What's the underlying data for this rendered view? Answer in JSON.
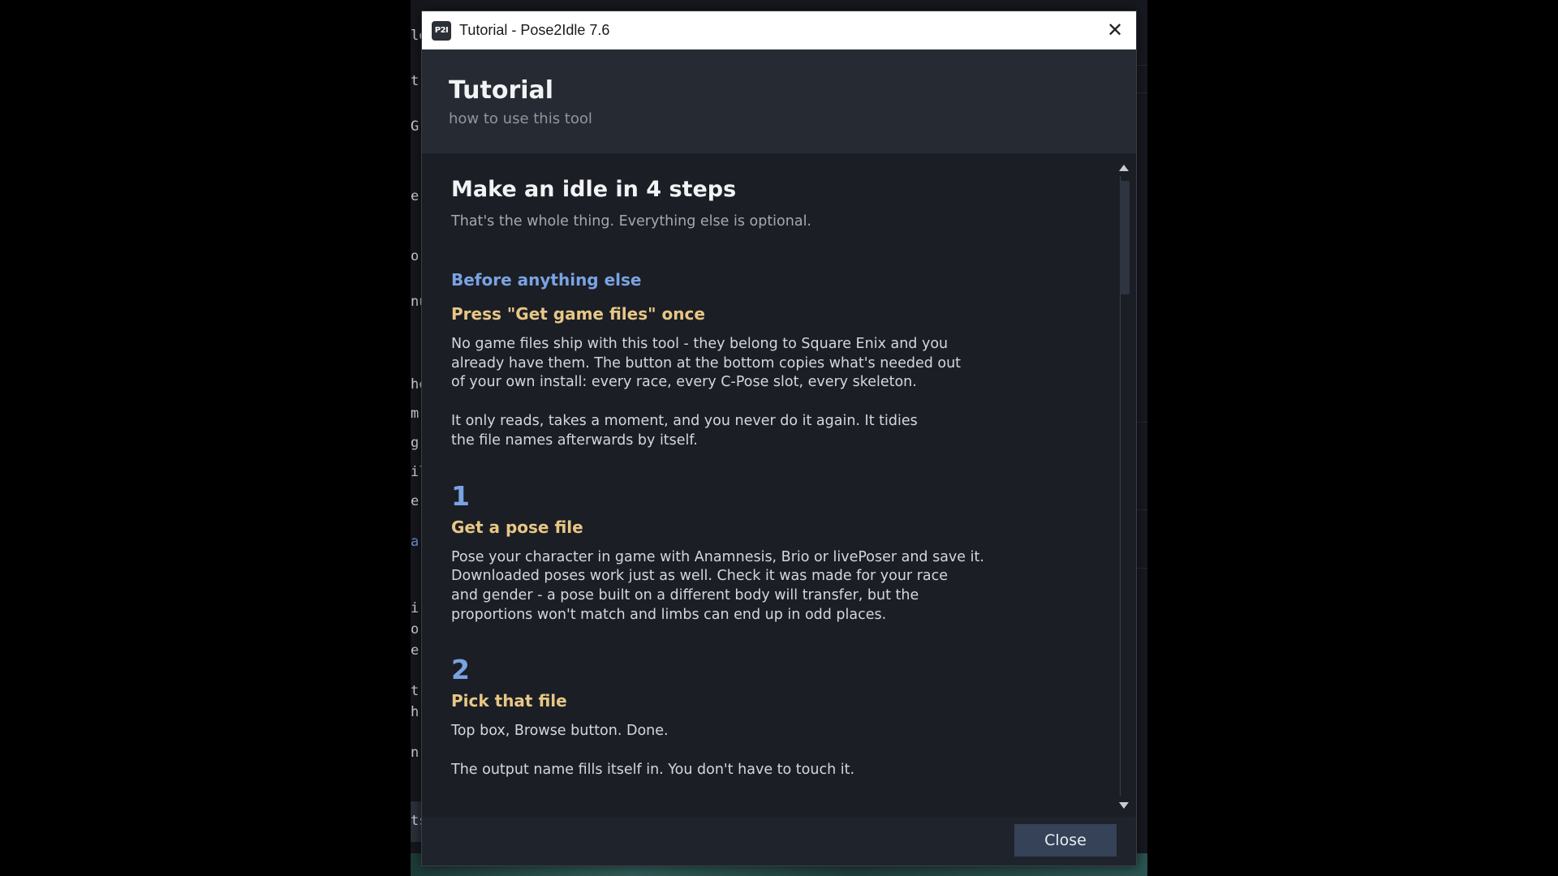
{
  "window": {
    "title": "Tutorial - Pose2Idle 7.6",
    "icon_label": "P2I"
  },
  "header": {
    "title": "Tutorial",
    "subtitle": "how to use this tool"
  },
  "content": {
    "heading": "Make an idle in 4 steps",
    "intro": "That's the whole thing. Everything else is optional.",
    "before_heading": "Before anything else",
    "before_title": "Press \"Get game files\" once",
    "before_para1": "No game files ship with this tool - they belong to Square Enix and you\nalready have them. The button at the bottom copies what's needed out\nof your own install: every race, every C-Pose slot, every skeleton.",
    "before_para2": "It only reads, takes a moment, and you never do it again. It tidies\nthe file names afterwards by itself.",
    "steps": [
      {
        "number": "1",
        "title": "Get a pose file",
        "para1": "Pose your character in game with Anamnesis, Brio or livePoser and save it.\nDownloaded poses work just as well. Check it was made for your race\nand gender - a pose built on a different body will transfer, but the\nproportions won't match and limbs can end up in odd places."
      },
      {
        "number": "2",
        "title": "Pick that file",
        "para1": "Top box, Browse button. Done.",
        "para2": "The output name fills itself in. You don't have to touch it."
      }
    ]
  },
  "footer": {
    "close_label": "Close"
  },
  "background": {
    "fragments": [
      "le",
      "t",
      "G",
      "e",
      "or",
      "nu",
      "he",
      "m",
      "g",
      "il",
      "er",
      "ar",
      "i",
      "o",
      "e",
      "t",
      "h",
      "n",
      "ts"
    ]
  },
  "colors": {
    "accent_blue": "#7aa3e3",
    "accent_gold": "#e8c785",
    "button": "#354257"
  }
}
